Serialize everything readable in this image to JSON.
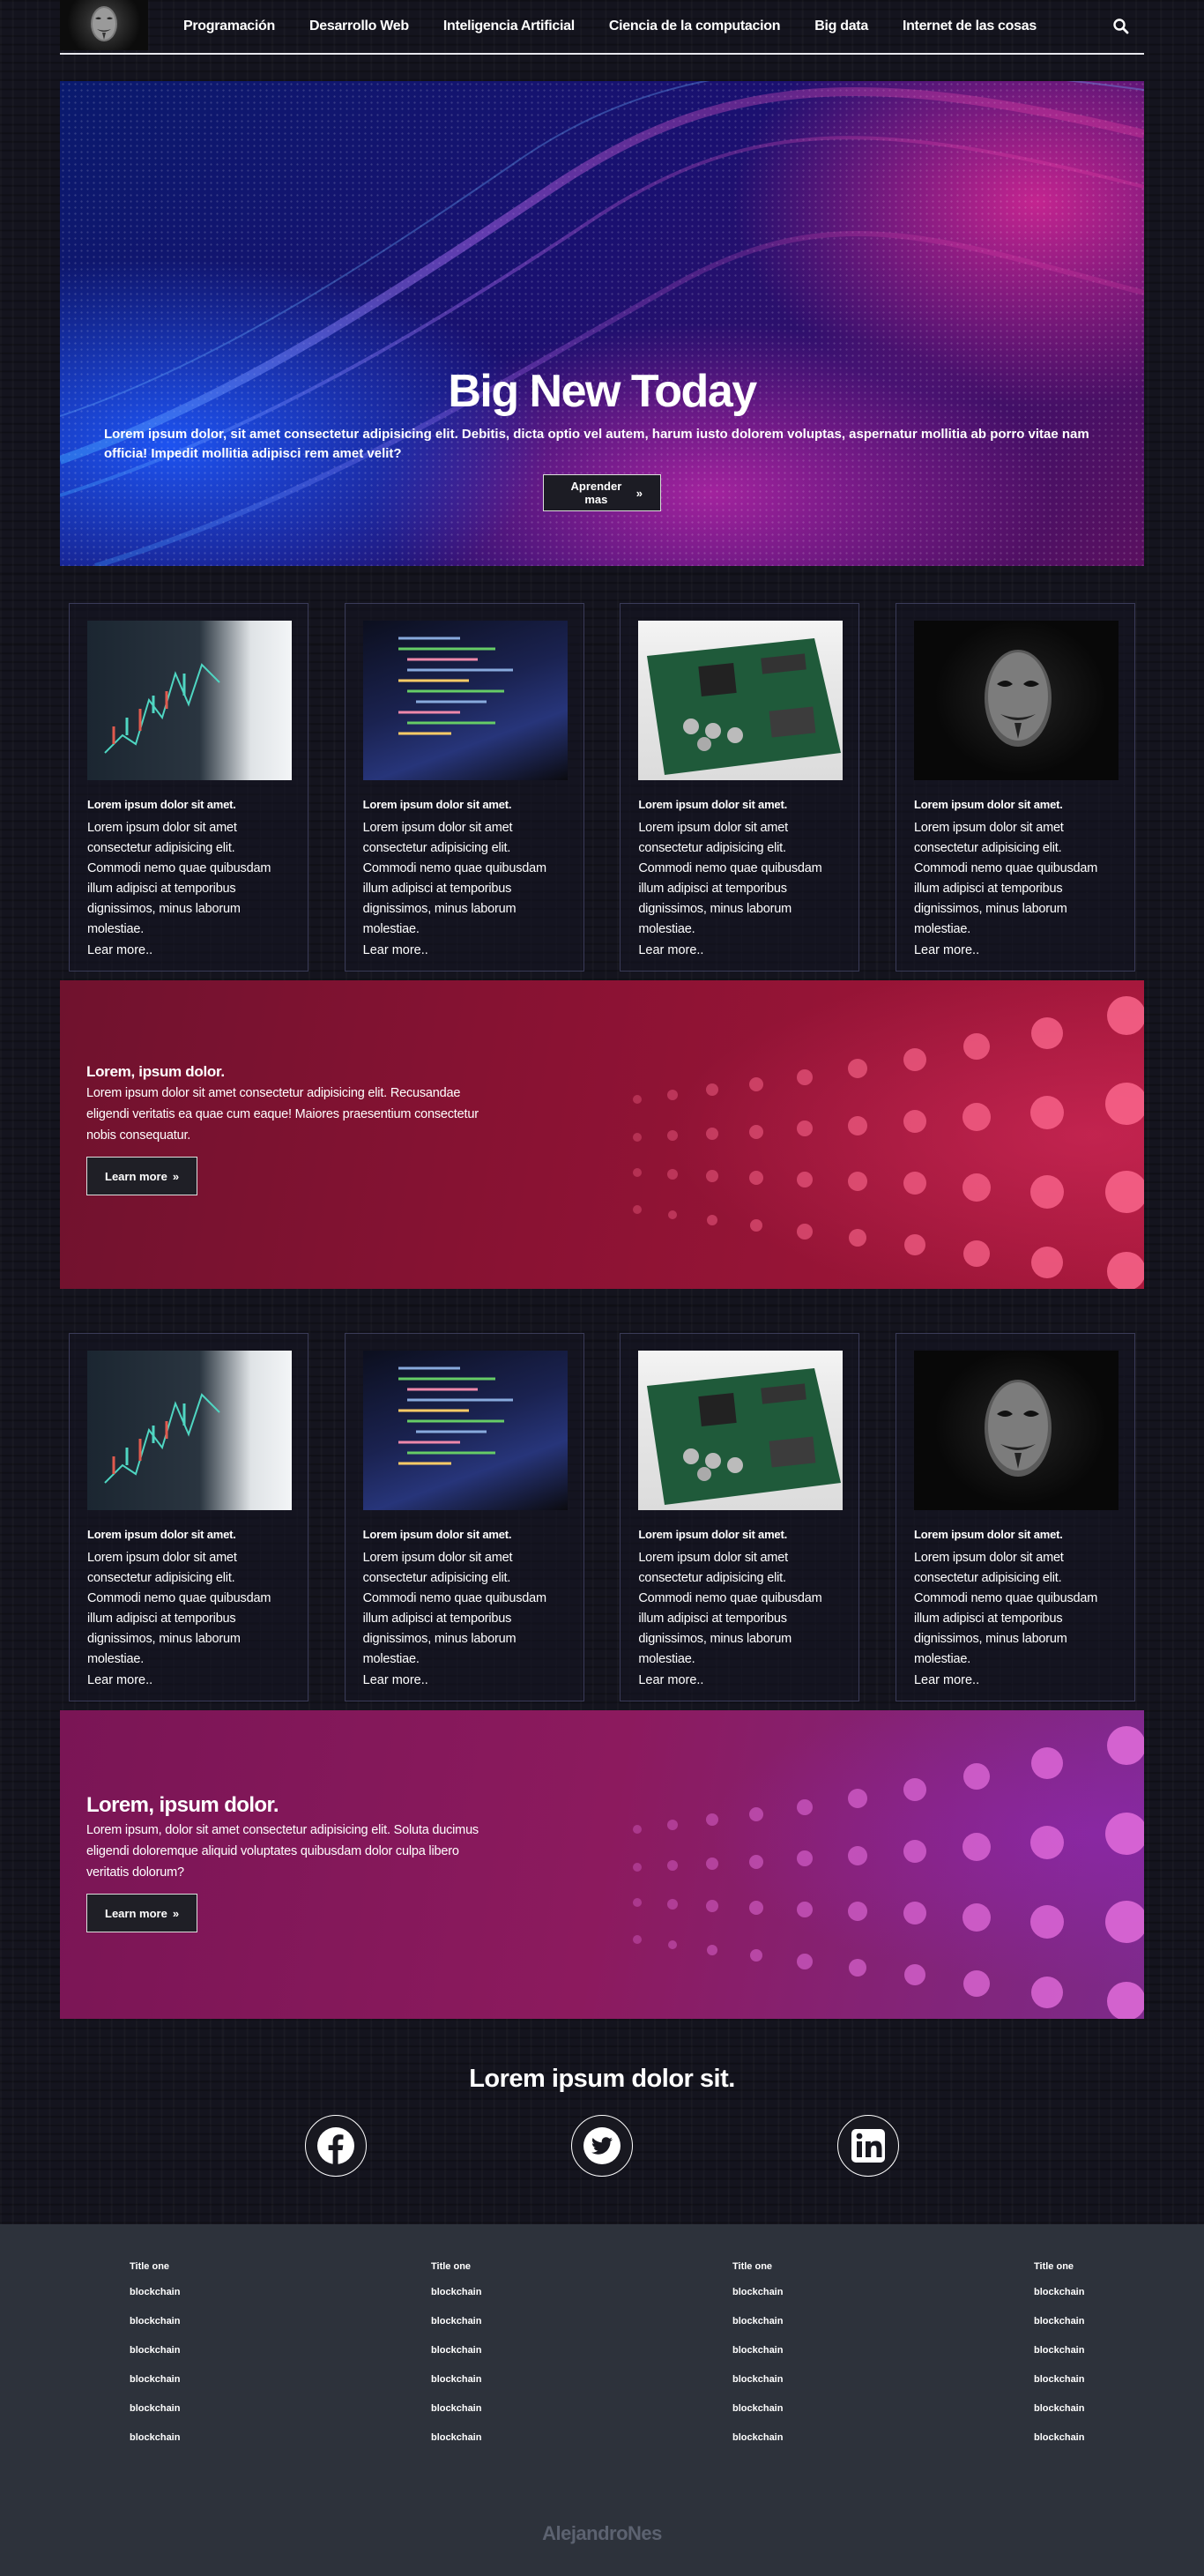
{
  "nav": {
    "links": [
      "Programación",
      "Desarrollo Web",
      "Inteligencia Artificial",
      "Ciencia de la computacion",
      "Big data",
      "Internet de las cosas"
    ]
  },
  "hero": {
    "title": "Big New Today",
    "text": "Lorem ipsum dolor, sit amet consectetur adipisicing elit. Debitis, dicta optio vel autem, harum iusto dolorem voluptas, aspernatur mollitia ab porro vitae nam officia! Impedit mollitia adipisci rem amet velit?",
    "button": "Aprender mas"
  },
  "cards_row_1": [
    {
      "title": "Lorem ipsum dolor sit amet.",
      "text": "Lorem ipsum dolor sit amet consectetur adipisicing elit. Commodi nemo quae quibusdam illum adipisci at temporibus dignissimos, minus laborum molestiae.",
      "link": "Lear more.."
    },
    {
      "title": "Lorem ipsum dolor sit amet.",
      "text": "Lorem ipsum dolor sit amet consectetur adipisicing elit. Commodi nemo quae quibusdam illum adipisci at temporibus dignissimos, minus laborum molestiae.",
      "link": "Lear more.."
    },
    {
      "title": "Lorem ipsum dolor sit amet.",
      "text": "Lorem ipsum dolor sit amet consectetur adipisicing elit. Commodi nemo quae quibusdam illum adipisci at temporibus dignissimos, minus laborum molestiae.",
      "link": "Lear more.."
    },
    {
      "title": "Lorem ipsum dolor sit amet.",
      "text": "Lorem ipsum dolor sit amet consectetur adipisicing elit. Commodi nemo quae quibusdam illum adipisci at temporibus dignissimos, minus laborum molestiae.",
      "link": "Lear more.."
    }
  ],
  "banner_1": {
    "title": "Lorem, ipsum dolor.",
    "text": "Lorem ipsum dolor sit amet consectetur adipisicing elit. Recusandae eligendi veritatis ea quae cum eaque! Maiores praesentium consectetur nobis consequatur.",
    "button": "Learn more"
  },
  "cards_row_2": [
    {
      "title": "Lorem ipsum dolor sit amet.",
      "text": "Lorem ipsum dolor sit amet consectetur adipisicing elit. Commodi nemo quae quibusdam illum adipisci at temporibus dignissimos, minus laborum molestiae.",
      "link": "Lear more.."
    },
    {
      "title": "Lorem ipsum dolor sit amet.",
      "text": "Lorem ipsum dolor sit amet consectetur adipisicing elit. Commodi nemo quae quibusdam illum adipisci at temporibus dignissimos, minus laborum molestiae.",
      "link": "Lear more.."
    },
    {
      "title": "Lorem ipsum dolor sit amet.",
      "text": "Lorem ipsum dolor sit amet consectetur adipisicing elit. Commodi nemo quae quibusdam illum adipisci at temporibus dignissimos, minus laborum molestiae.",
      "link": "Lear more.."
    },
    {
      "title": "Lorem ipsum dolor sit amet.",
      "text": "Lorem ipsum dolor sit amet consectetur adipisicing elit. Commodi nemo quae quibusdam illum adipisci at temporibus dignissimos, minus laborum molestiae.",
      "link": "Lear more.."
    }
  ],
  "banner_2": {
    "title": "Lorem, ipsum dolor.",
    "text": "Lorem ipsum, dolor sit amet consectetur adipisicing elit. Soluta ducimus eligendi doloremque aliquid voluptates quibusdam dolor culpa libero veritatis dolorum?",
    "button": "Learn more"
  },
  "social": {
    "title": "Lorem ipsum dolor sit.",
    "icons": [
      "facebook-icon",
      "twitter-icon",
      "linkedin-icon"
    ]
  },
  "footer": {
    "columns": [
      {
        "title": "Title one",
        "links": [
          "blockchain",
          "blockchain",
          "blockchain",
          "blockchain",
          "blockchain",
          "blockchain"
        ]
      },
      {
        "title": "Title one",
        "links": [
          "blockchain",
          "blockchain",
          "blockchain",
          "blockchain",
          "blockchain",
          "blockchain"
        ]
      },
      {
        "title": "Title one",
        "links": [
          "blockchain",
          "blockchain",
          "blockchain",
          "blockchain",
          "blockchain",
          "blockchain"
        ]
      },
      {
        "title": "Title one",
        "links": [
          "blockchain",
          "blockchain",
          "blockchain",
          "blockchain",
          "blockchain",
          "blockchain"
        ]
      }
    ],
    "brand": "AlejandroNes"
  },
  "colors": {
    "page_bg": "#14141e",
    "footer_bg": "#2d323b",
    "card_border": "#3a3b58",
    "banner_1": "#8a1233",
    "banner_2": "#8c1a5e",
    "hero_blue": "#1e5aff",
    "hero_magenta": "#dc2896"
  }
}
